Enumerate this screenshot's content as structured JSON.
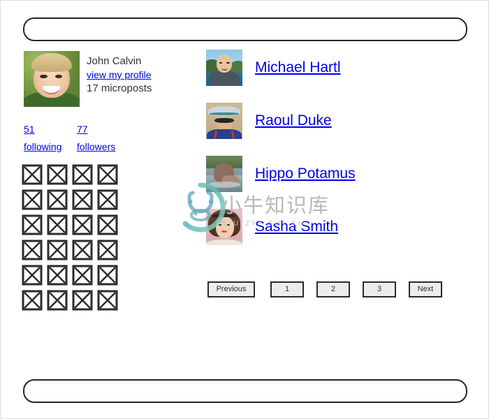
{
  "page": {
    "header_bar_label": "",
    "footer_bar_label": ""
  },
  "sidebar": {
    "avatar_icon": "gravatar-image",
    "name": "John Calvin",
    "profile_link": "view my profile",
    "microposts": "17 microposts",
    "stats": [
      {
        "count": "51",
        "label": "following"
      },
      {
        "count": "77",
        "label": "followers"
      }
    ],
    "micropost_grid": {
      "placeholder_icon": "broken-image-icon",
      "columns": 4,
      "rows": 6,
      "count": 24
    }
  },
  "users": [
    {
      "name": "Michael Hartl",
      "avatar_icon": "user-avatar-image"
    },
    {
      "name": "Raoul Duke",
      "avatar_icon": "user-avatar-image"
    },
    {
      "name": "Hippo Potamus",
      "avatar_icon": "user-avatar-image"
    },
    {
      "name": "Sasha Smith",
      "avatar_icon": "user-avatar-image"
    }
  ],
  "pagination": {
    "previous": "Previous",
    "pages": [
      "1",
      "2",
      "3"
    ],
    "next": "Next"
  },
  "watermark": {
    "chinese": "小牛知识库",
    "pinyin": "NIU ZHI SHI KU",
    "logo_icon": "bull-circle-logo"
  },
  "colors": {
    "link": "#0000ee",
    "text": "#333333",
    "outline": "#262626",
    "button_face": "#ececec",
    "page_border": "#dcdcdc",
    "watermark": "#b8b8b8"
  }
}
